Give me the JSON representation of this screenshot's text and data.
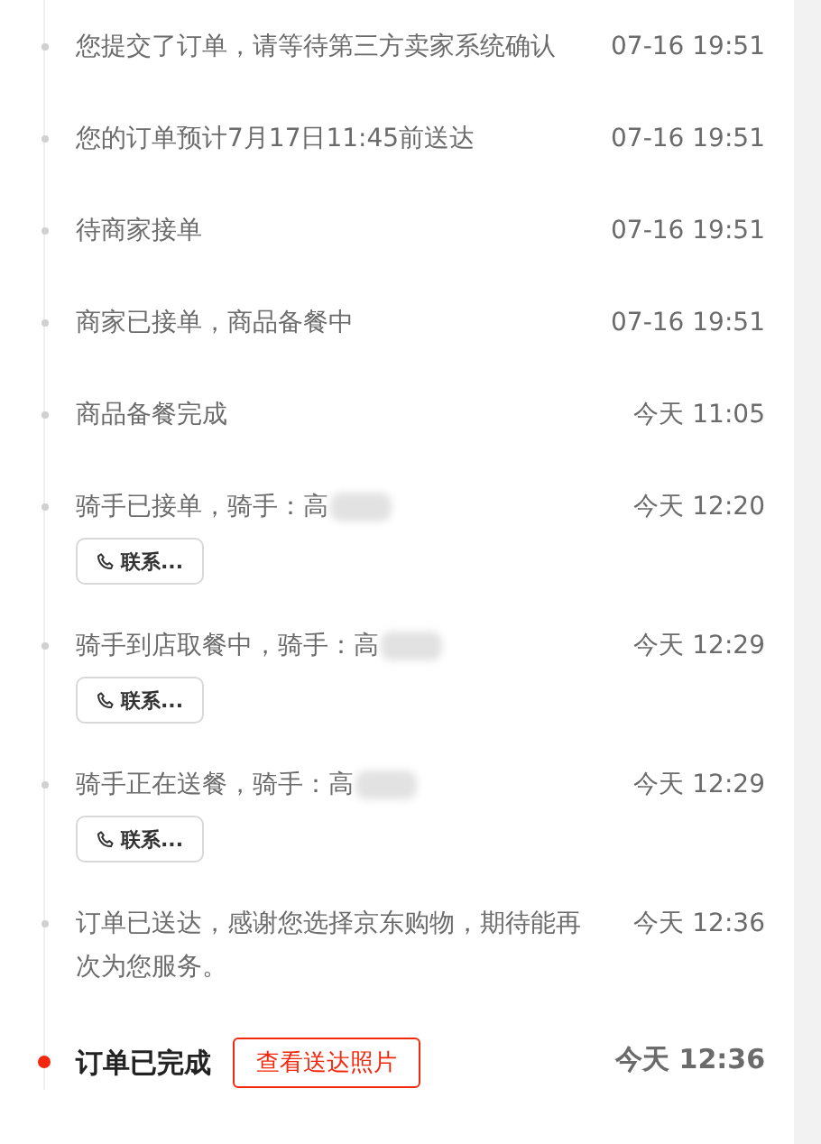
{
  "events": [
    {
      "text": "您提交了订单，请等待第三方卖家系统确认",
      "time": "07-16 19:51",
      "current": false
    },
    {
      "text": "您的订单预计7月17日11:45前送达",
      "time": "07-16 19:51",
      "current": false
    },
    {
      "text": "待商家接单",
      "time": "07-16 19:51",
      "current": false
    },
    {
      "text": "商家已接单，商品备餐中",
      "time": "07-16 19:51",
      "current": false
    },
    {
      "text": "商品备餐完成",
      "time": "今天 11:05",
      "current": false
    },
    {
      "text": "骑手已接单，骑手：高",
      "time": "今天 12:20",
      "current": false,
      "redacted": true,
      "action": {
        "kind": "contact",
        "label": "联系..."
      }
    },
    {
      "text": "骑手到店取餐中，骑手：高",
      "time": "今天 12:29",
      "current": false,
      "redacted": true,
      "action": {
        "kind": "contact",
        "label": "联系..."
      }
    },
    {
      "text": "骑手正在送餐，骑手：高",
      "time": "今天 12:29",
      "current": false,
      "redacted": true,
      "action": {
        "kind": "contact",
        "label": "联系..."
      }
    },
    {
      "text": "订单已送达，感谢您选择京东购物，期待能再次为您服务。",
      "time": "今天 12:36",
      "current": false
    },
    {
      "text": "订单已完成",
      "time": "今天 12:36",
      "current": true,
      "action": {
        "kind": "photo",
        "label": "查看送达照片"
      }
    }
  ]
}
